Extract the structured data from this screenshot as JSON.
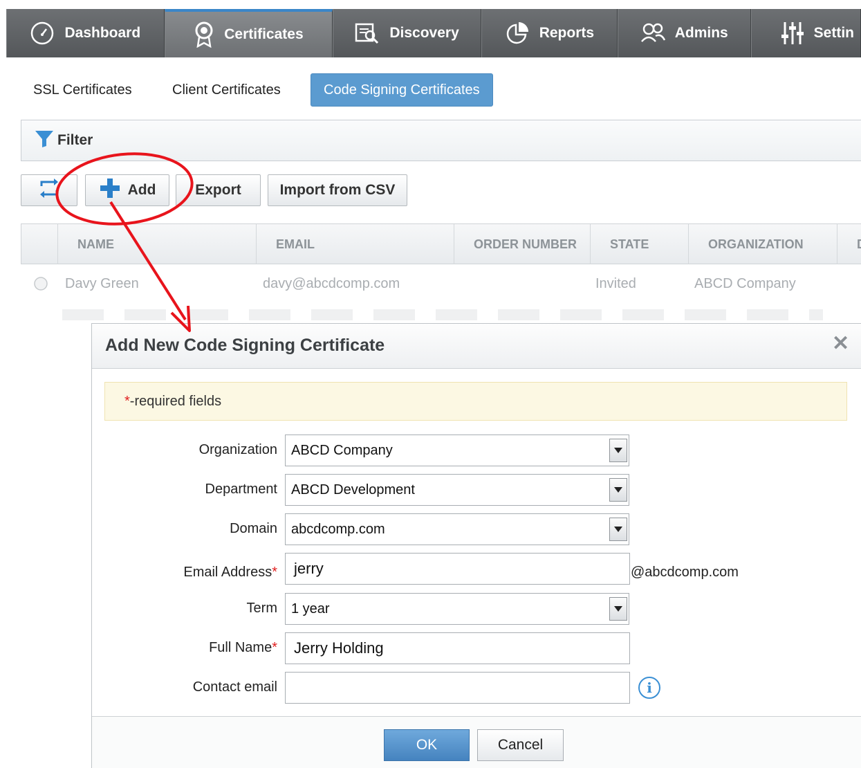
{
  "nav": {
    "tabs": [
      {
        "label": "Dashboard",
        "icon": "gauge-icon"
      },
      {
        "label": "Certificates",
        "icon": "certificate-icon",
        "active": true
      },
      {
        "label": "Discovery",
        "icon": "discovery-icon"
      },
      {
        "label": "Reports",
        "icon": "reports-icon"
      },
      {
        "label": "Admins",
        "icon": "admins-icon"
      },
      {
        "label": "Settin",
        "icon": "settings-sliders-icon"
      }
    ]
  },
  "subtabs": [
    {
      "label": "SSL Certificates"
    },
    {
      "label": "Client Certificates"
    },
    {
      "label": "Code Signing Certificates",
      "active": true
    }
  ],
  "filter": {
    "label": "Filter"
  },
  "toolbar": {
    "add_label": "Add",
    "export_label": "Export",
    "import_label": "Import from CSV"
  },
  "grid": {
    "columns": [
      "NAME",
      "EMAIL",
      "ORDER NUMBER",
      "STATE",
      "ORGANIZATION",
      "D"
    ],
    "rows": [
      {
        "name": "Davy Green",
        "email": "davy@abcdcomp.com",
        "order_number": "",
        "state": "Invited",
        "organization": "ABCD Company"
      }
    ]
  },
  "dialog": {
    "title": "Add New Code Signing Certificate",
    "required_note_star": "*",
    "required_note": "-required fields",
    "fields": {
      "organization": {
        "label": "Organization",
        "value": "ABCD Company"
      },
      "department": {
        "label": "Department",
        "value": "ABCD Development"
      },
      "domain": {
        "label": "Domain",
        "value": "abcdcomp.com"
      },
      "email": {
        "label": "Email Address",
        "value": "jerry",
        "suffix": "@abcdcomp.com",
        "required": "*"
      },
      "term": {
        "label": "Term",
        "value": "1 year"
      },
      "full_name": {
        "label": "Full Name",
        "value": "Jerry Holding",
        "required": "*"
      },
      "contact_email": {
        "label": "Contact email",
        "value": ""
      }
    },
    "ok_label": "OK",
    "cancel_label": "Cancel"
  },
  "colors": {
    "accent": "#5b9bd0",
    "nav_bg": "#5e6164",
    "annotation": "#e8141c",
    "required_star": "#e02020"
  }
}
